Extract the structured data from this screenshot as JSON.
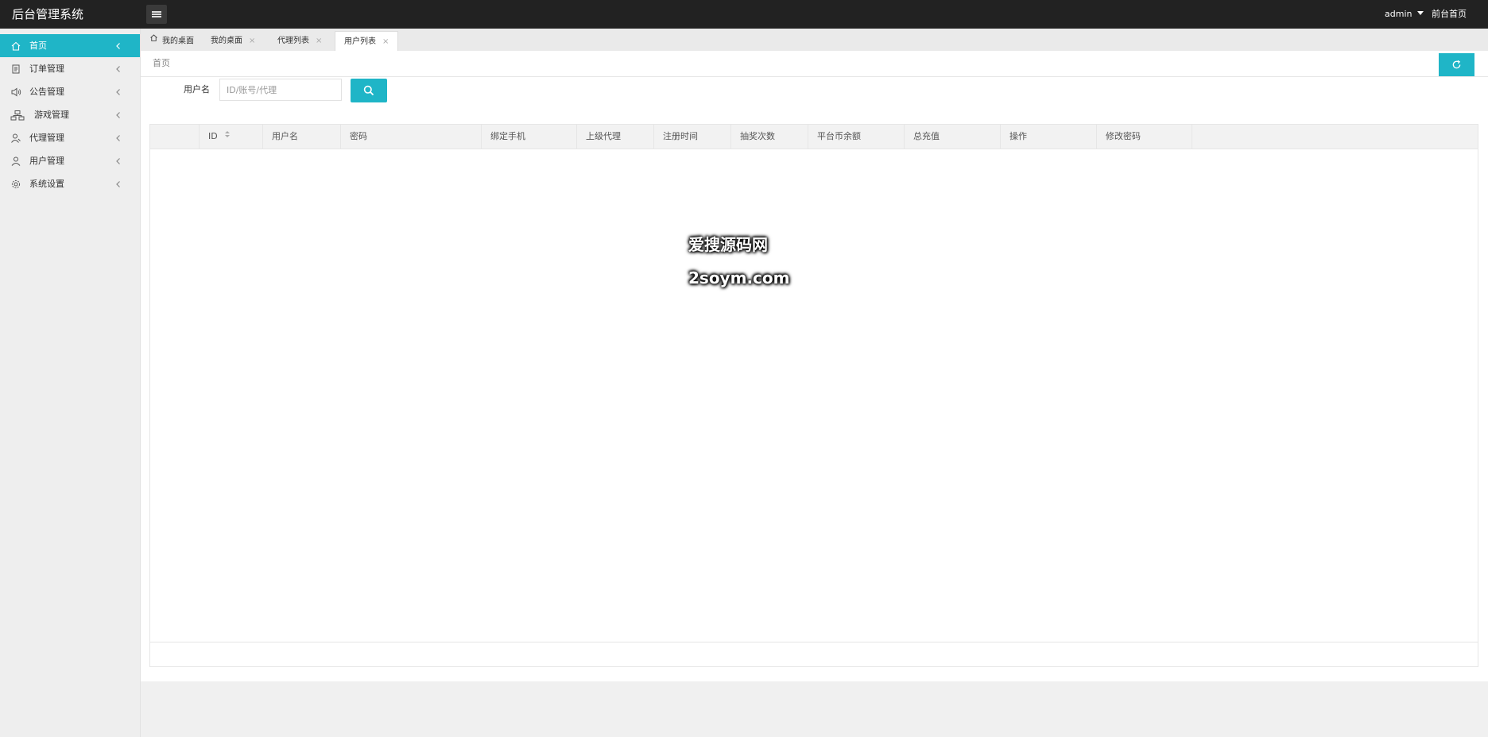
{
  "app": {
    "title": "后台管理系统"
  },
  "topbar": {
    "user": "admin",
    "front_link": "前台首页"
  },
  "sidebar": {
    "items": [
      {
        "label": "首页",
        "icon": "home-icon",
        "active": true
      },
      {
        "label": "订单管理",
        "icon": "document-icon"
      },
      {
        "label": "公告管理",
        "icon": "speaker-icon"
      },
      {
        "label": "游戏管理",
        "icon": "sitemap-icon"
      },
      {
        "label": "代理管理",
        "icon": "agent-icon"
      },
      {
        "label": "用户管理",
        "icon": "user-icon"
      },
      {
        "label": "系统设置",
        "icon": "gear-icon"
      }
    ]
  },
  "tabs": [
    {
      "label": "我的桌面",
      "closable": false,
      "icon": "home-icon"
    },
    {
      "label": "我的桌面",
      "closable": true
    },
    {
      "label": "代理列表",
      "closable": true
    },
    {
      "label": "用户列表",
      "closable": true,
      "active": true
    }
  ],
  "tab_close_glyph": "×",
  "breadcrumb": "首页",
  "search": {
    "label": "用户名",
    "placeholder": "ID/账号/代理"
  },
  "table": {
    "columns": [
      "ID",
      "用户名",
      "密码",
      "绑定手机",
      "上级代理",
      "注册时间",
      "抽奖次数",
      "平台币余额",
      "总充值",
      "操作",
      "修改密码"
    ],
    "rows": []
  },
  "watermark": {
    "line1": "爱搜源码网",
    "line2": "2soym.com"
  },
  "colors": {
    "accent": "#1fb5c7",
    "topbar": "#222222",
    "sidebar_bg": "#eeeeee"
  }
}
